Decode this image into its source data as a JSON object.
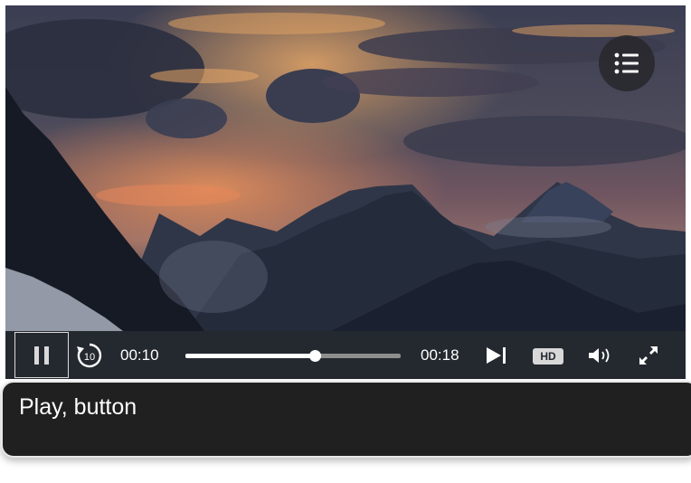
{
  "player": {
    "scene": "alpine-mountain-sunset",
    "chapters_icon": "list-icon",
    "controls": {
      "pause_icon": "pause-icon",
      "rewind_icon": "rewind-10-icon",
      "rewind_seconds": "10",
      "current_time": "00:10",
      "duration": "00:18",
      "progress": 0.6,
      "skip_icon": "skip-next-icon",
      "hd_label": "HD",
      "volume_icon": "volume-icon",
      "fullscreen_icon": "fullscreen-icon"
    }
  },
  "tooltip": {
    "text": "Play, button"
  },
  "colors": {
    "control_bar": "#24282f",
    "progress_fill": "#ffffff",
    "progress_track": "#8e8e8e",
    "tooltip_bg": "#202020"
  }
}
